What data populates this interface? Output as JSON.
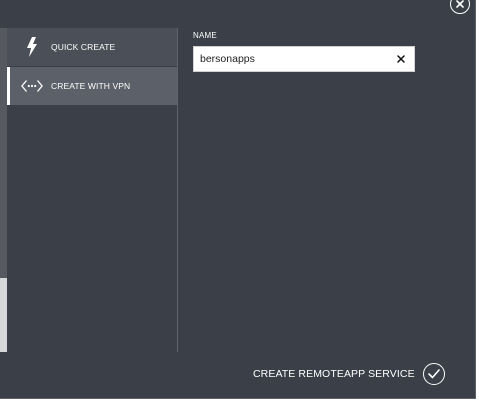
{
  "nav": {
    "items": [
      {
        "label": "QUICK CREATE",
        "icon": "lightning-icon",
        "active": false
      },
      {
        "label": "CREATE WITH VPN",
        "icon": "vpn-icon",
        "active": true
      }
    ]
  },
  "form": {
    "name_label": "NAME",
    "name_value": "bersonapps"
  },
  "footer": {
    "action_label": "CREATE REMOTEAPP SERVICE"
  },
  "colors": {
    "background": "#3a3f48",
    "nav_hover": "#4a4f58",
    "nav_active": "#5c6068"
  }
}
